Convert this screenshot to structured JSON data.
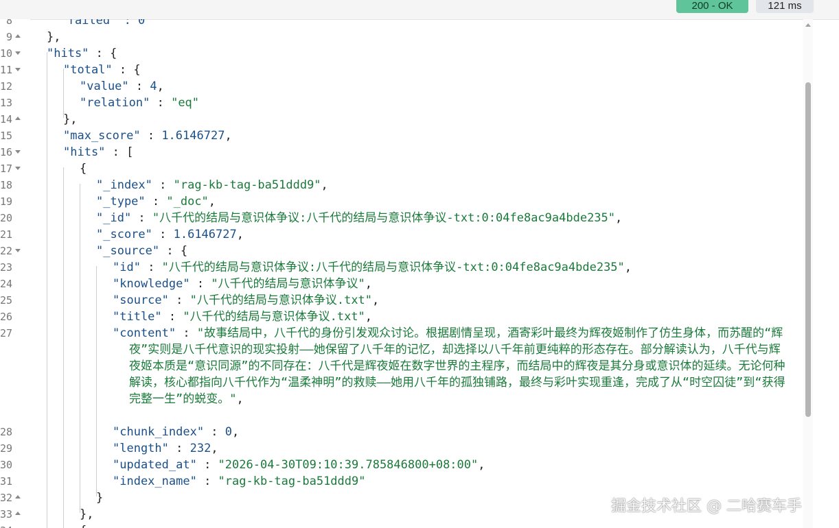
{
  "header": {
    "status": "200 - OK",
    "time": "121 ms"
  },
  "lines": {
    "l8": {
      "num": "8",
      "text": "  \"failed\" : 0"
    },
    "l9": {
      "num": "9",
      "text": "},"
    },
    "l10": {
      "num": "10",
      "key": "\"hits\"",
      "rest": " : {"
    },
    "l11": {
      "num": "11",
      "key": "\"total\"",
      "rest": " : {"
    },
    "l12": {
      "num": "12",
      "key": "\"value\"",
      "sep": " : ",
      "val": "4",
      "tail": ","
    },
    "l13": {
      "num": "13",
      "key": "\"relation\"",
      "sep": " : ",
      "val": "\"eq\""
    },
    "l14": {
      "num": "14",
      "text": "},"
    },
    "l15": {
      "num": "15",
      "key": "\"max_score\"",
      "sep": " : ",
      "val": "1.6146727",
      "tail": ","
    },
    "l16": {
      "num": "16",
      "key": "\"hits\"",
      "rest": " : ["
    },
    "l17": {
      "num": "17",
      "text": "{"
    },
    "l18": {
      "num": "18",
      "key": "\"_index\"",
      "sep": " : ",
      "val": "\"rag-kb-tag-ba51ddd9\"",
      "tail": ","
    },
    "l19": {
      "num": "19",
      "key": "\"_type\"",
      "sep": " : ",
      "val": "\"_doc\"",
      "tail": ","
    },
    "l20": {
      "num": "20",
      "key": "\"_id\"",
      "sep": " : ",
      "val": "\"八千代的结局与意识体争议:八千代的结局与意识体争议-txt:0:04fe8ac9a4bde235\"",
      "tail": ","
    },
    "l21": {
      "num": "21",
      "key": "\"_score\"",
      "sep": " : ",
      "val": "1.6146727",
      "tail": ","
    },
    "l22": {
      "num": "22",
      "key": "\"_source\"",
      "rest": " : {"
    },
    "l23": {
      "num": "23",
      "key": "\"id\"",
      "sep": " : ",
      "val": "\"八千代的结局与意识体争议:八千代的结局与意识体争议-txt:0:04fe8ac9a4bde235\"",
      "tail": ","
    },
    "l24": {
      "num": "24",
      "key": "\"knowledge\"",
      "sep": " : ",
      "val": "\"八千代的结局与意识体争议\"",
      "tail": ","
    },
    "l25": {
      "num": "25",
      "key": "\"source\"",
      "sep": " : ",
      "val": "\"八千代的结局与意识体争议.txt\"",
      "tail": ","
    },
    "l26": {
      "num": "26",
      "key": "\"title\"",
      "sep": " : ",
      "val": "\"八千代的结局与意识体争议.txt\"",
      "tail": ","
    },
    "l27": {
      "num": "27",
      "key": "\"content\"",
      "sep": " : ",
      "val": "\"故事结局中，八千代的身份引发观众讨论。根据剧情呈现，酒寄彩叶最终为辉夜姬制作了仿生身体，而苏醒的“辉夜”实则是八千代意识的现实投射——她保留了八千年的记忆，却选择以八千年前更纯粹的形态存在。部分解读认为，八千代与辉夜姬本质是“意识同源”的不同存在：八千代是辉夜姬在数字世界的主程序，而结局中的辉夜是其分身或意识体的延续。无论何种解读，核心都指向八千代作为“温柔神明”的救赎——她用八千年的孤独铺路，最终与彩叶实现重逢，完成了从“时空囚徒”到“获得完整一生”的蜕变。\"",
      "tail": ","
    },
    "l28": {
      "num": "28",
      "key": "\"chunk_index\"",
      "sep": " : ",
      "val": "0",
      "tail": ","
    },
    "l29": {
      "num": "29",
      "key": "\"length\"",
      "sep": " : ",
      "val": "232",
      "tail": ","
    },
    "l30": {
      "num": "30",
      "key": "\"updated_at\"",
      "sep": " : ",
      "val": "\"2026-04-30T09:10:39.785846800+08:00\"",
      "tail": ","
    },
    "l31": {
      "num": "31",
      "key": "\"index_name\"",
      "sep": " : ",
      "val": "\"rag-kb-tag-ba51ddd9\""
    },
    "l32": {
      "num": "32",
      "text": "}"
    },
    "l33": {
      "num": "33",
      "text": "},"
    },
    "l34": {
      "num": "34",
      "text": "{"
    }
  },
  "watermark": "掘金技术社区 @ 二哈赛车手"
}
